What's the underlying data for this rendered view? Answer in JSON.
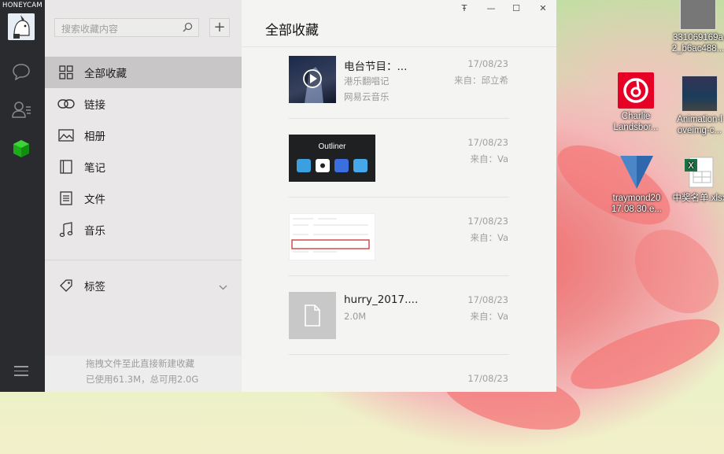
{
  "window": {
    "brand": "HONEYCAM",
    "controls": {
      "pin": "Ŧ",
      "minimize": "—",
      "maximize": "☐",
      "close": "✕"
    }
  },
  "sidebar": {
    "search_placeholder": "搜索收藏内容",
    "add_label": "+",
    "items": [
      {
        "label": "全部收藏",
        "icon": "grid-icon"
      },
      {
        "label": "链接",
        "icon": "link-icon"
      },
      {
        "label": "相册",
        "icon": "image-icon"
      },
      {
        "label": "笔记",
        "icon": "notebook-icon"
      },
      {
        "label": "文件",
        "icon": "file-text-icon"
      },
      {
        "label": "音乐",
        "icon": "music-note-icon"
      }
    ],
    "tags_label": "标签",
    "footer_hint": "拖拽文件至此直接新建收藏",
    "footer_usage": "已使用61.3M，总可用2.0G"
  },
  "main": {
    "title": "全部收藏",
    "items": [
      {
        "title": "电台节目：...",
        "line1": "港乐翻唱记",
        "line2": "网易云音乐",
        "date": "17/08/23",
        "source": "来自：邱立希",
        "type": "music"
      },
      {
        "title": "",
        "date": "17/08/23",
        "source": "来自：Va",
        "type": "image",
        "thumb_text": "Outliner"
      },
      {
        "title": "",
        "date": "17/08/23",
        "source": "来自：Va",
        "type": "screenshot"
      },
      {
        "title": "hurry_2017....",
        "line1": "2.0M",
        "date": "17/08/23",
        "source": "来自：Va",
        "type": "file"
      },
      {
        "date": "17/08/23",
        "type": "partial"
      }
    ]
  },
  "desktop": {
    "icons": [
      {
        "label": "33106916X2_b6ac488...",
        "short": "331069169a\n2_b6ac488..."
      },
      {
        "label": "Charlie Landsbor..."
      },
      {
        "label": "Animation-l oveimg-c..."
      },
      {
        "label": "traymond20 17.08.30.e..."
      },
      {
        "label": "中奖名单.xlsx"
      }
    ]
  },
  "colors": {
    "leftbar": "#2a2b2e",
    "sidebar": "#e9e7e7",
    "active": "#c8c6c6",
    "main": "#f4f4f3",
    "wechat_green": "#1aad19",
    "netease_red": "#e60026"
  }
}
